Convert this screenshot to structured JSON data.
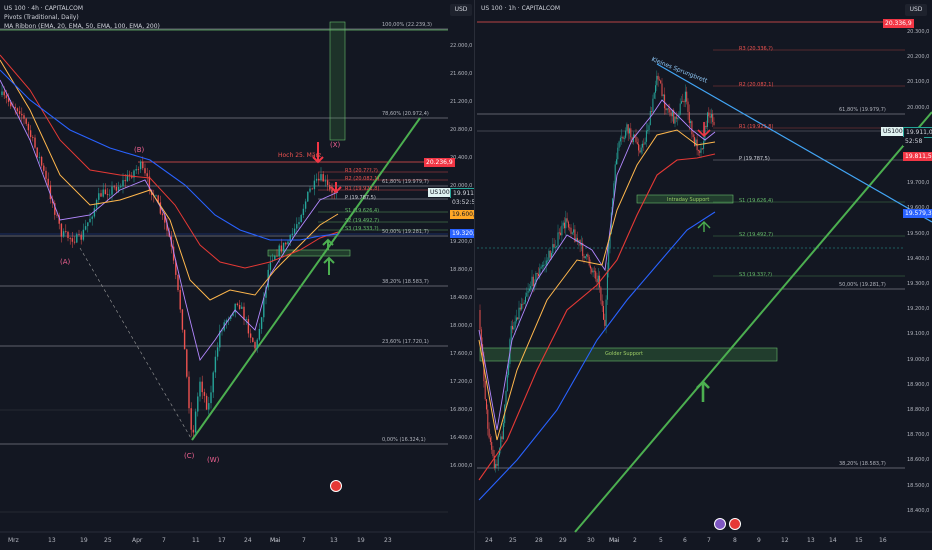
{
  "left": {
    "header": {
      "title": "US 100 · 4h · CAPITALCOM",
      "indicator1": "Pivots (Traditional, Daily)",
      "indicator2": "MA Ribbon (EMA, 20, EMA, 50, EMA, 100, EMA, 200)"
    },
    "currency": "USD",
    "price_scale": [
      "22.000,0",
      "21.600,0",
      "21.200,0",
      "20.800,0",
      "20.400,0",
      "20.000,0",
      "19.600,0",
      "19.200,0",
      "18.800,0",
      "18.400,0",
      "18.000,0",
      "17.600,0",
      "17.200,0",
      "16.800,0",
      "16.400,0",
      "16.000,0"
    ],
    "date_axis": [
      "Mrz",
      "13",
      "19",
      "25",
      "Apr",
      "7",
      "11",
      "17",
      "24",
      "Mai",
      "7",
      "13",
      "19",
      "23"
    ],
    "fib_labels": [
      "100,00% (22.239,3)",
      "78,60% (20.972,4)",
      "61,80% (19.979,7)",
      "50,00% (19.281,7)",
      "38,20% (18.583,7)",
      "23,60% (17.720,1)",
      "0,00% (16.324,1)"
    ],
    "pivot_labels": [
      "R3 (20.7??,?)",
      "R2 (20.082,1)",
      "R1 (19.921,8)",
      "P (19.787,5)",
      "S1 (19.626,4)",
      "S2 (19.492,7)",
      "S3 (19.333,?)"
    ],
    "price_tags": {
      "red": "20.236,9",
      "symbol": "US100",
      "last": "19.911,0",
      "countdown": "03:52:58",
      "orange": "19.600,4",
      "blue": "19.320,7"
    },
    "annotations": {
      "hoch": "Hoch 25. März",
      "wave_a": "(A)",
      "wave_b": "(B)",
      "wave_c": "(C)",
      "wave_w": "(W)",
      "wave_x": "(X)"
    },
    "colors": {
      "bull": "#26a69a",
      "bear": "#ef5350",
      "ema20": "#b388ff",
      "ema50": "#ffb74d",
      "ema100": "#e53935",
      "ema200": "#2962ff",
      "trend": "#4caf50"
    }
  },
  "right": {
    "header": {
      "title": "US 100 · 1h · CAPITALCOM"
    },
    "currency": "USD",
    "price_scale": [
      "20.300,0",
      "20.200,0",
      "20.100,0",
      "20.000,0",
      "19.900,0",
      "19.800,0",
      "19.700,0",
      "19.600,0",
      "19.500,0",
      "19.400,0",
      "19.300,0",
      "19.200,0",
      "19.100,0",
      "19.000,0",
      "18.900,0",
      "18.800,0",
      "18.700,0",
      "18.600,0",
      "18.500,0",
      "18.400,0"
    ],
    "date_axis": [
      "24",
      "25",
      "28",
      "29",
      "30",
      "Mai",
      "2",
      "5",
      "6",
      "7",
      "8",
      "9",
      "12",
      "13",
      "14",
      "15",
      "16"
    ],
    "fib_labels": [
      "61,80% (19.979,7)",
      "50,00% (19.281,7)",
      "38,20% (18.583,7)"
    ],
    "pivot_labels": [
      "R3 (20.336,?)",
      "R2 (20.082,1)",
      "R1 (19.921,8)",
      "P (19.787,5)",
      "S1 (19.626,4)",
      "S2 (19.492,7)",
      "S3 (19.33?,?)"
    ],
    "price_tags": {
      "top": "20.336,9",
      "symbol": "US100",
      "last": "19.911,0",
      "countdown": "52:58",
      "red": "19.811,5",
      "blue": "19.579,3"
    },
    "annotations": {
      "sprungbrett": "Kleines Sprungbrett",
      "intraday": "Intraday Support",
      "gold": "Golder Support"
    }
  }
}
